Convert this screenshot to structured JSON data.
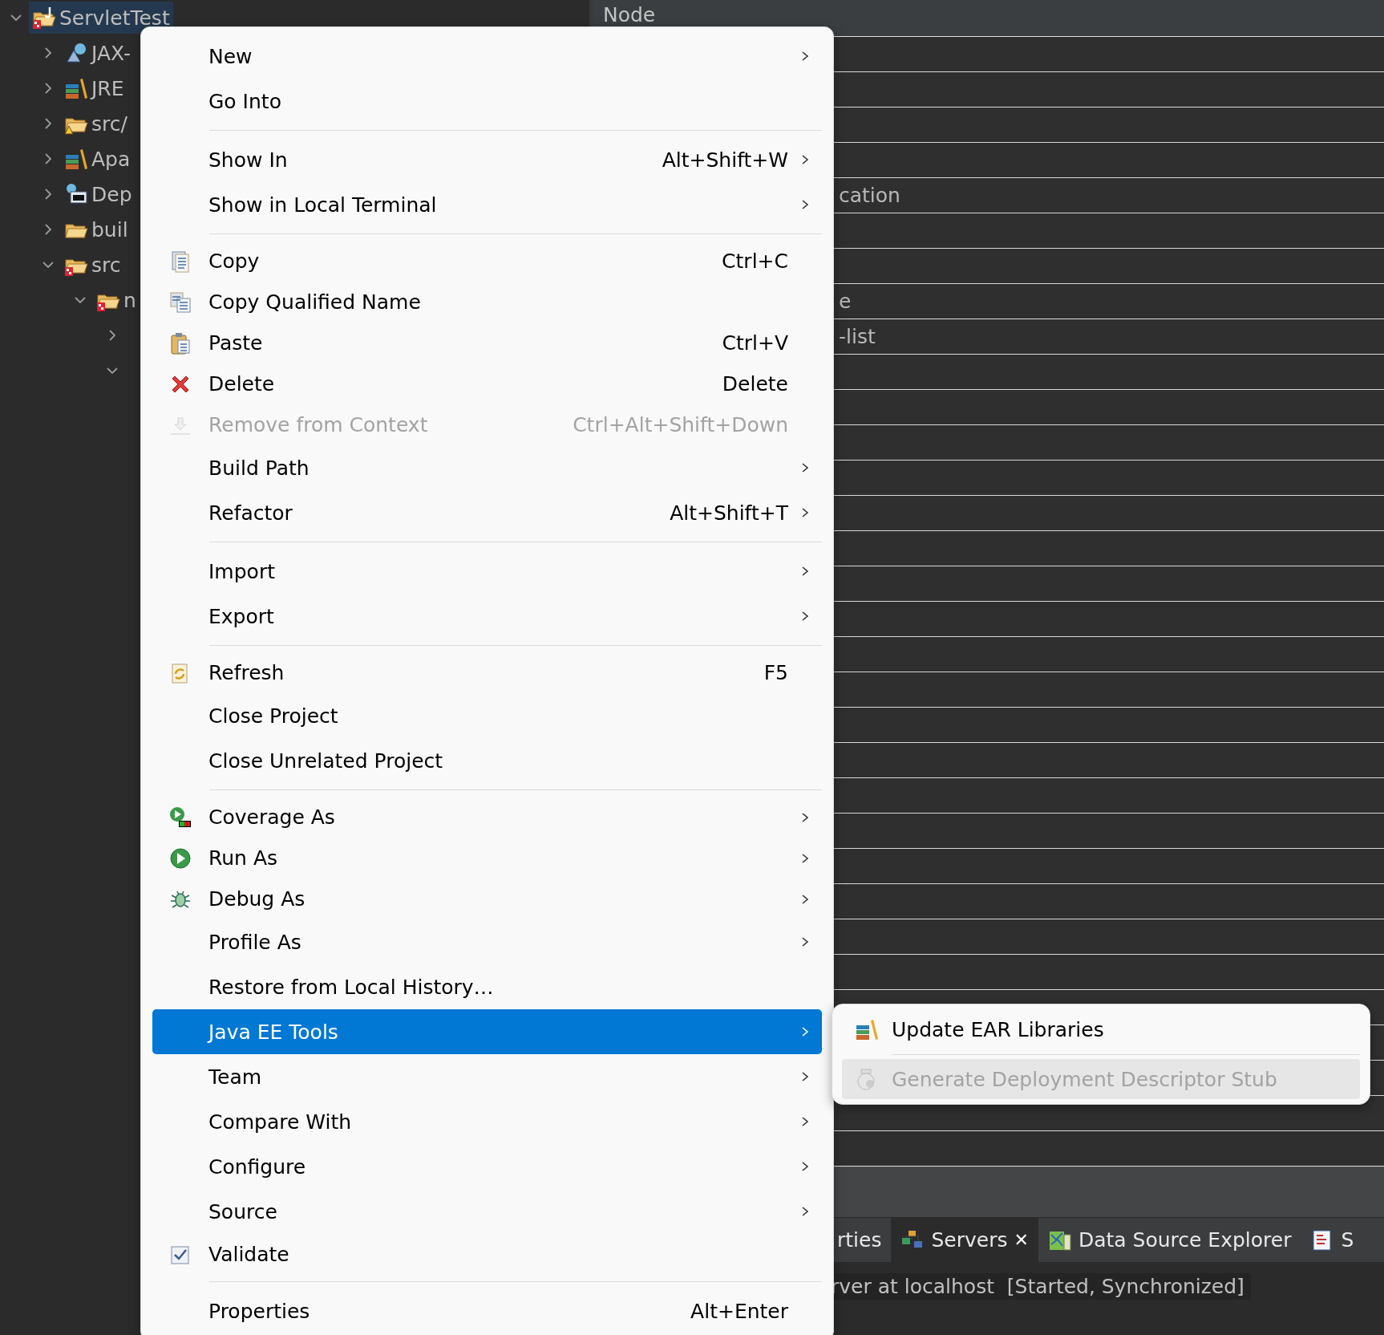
{
  "project_tree": {
    "items": [
      {
        "label": "ServletTest",
        "expanded": true,
        "selected": true,
        "children": [
          {
            "label": "JAX-",
            "expanded": false,
            "selected": false
          },
          {
            "label": "JRE",
            "expanded": false,
            "selected": false
          },
          {
            "label": "src/",
            "expanded": false,
            "selected": false
          },
          {
            "label": "Apa",
            "expanded": false,
            "selected": false
          },
          {
            "label": "Dep",
            "expanded": false,
            "selected": false
          },
          {
            "label": "buil",
            "expanded": false,
            "selected": false
          },
          {
            "label": "src",
            "expanded": true,
            "selected": false,
            "children": [
              {
                "label": "n",
                "expanded": true,
                "selected": false,
                "children": [
                  {
                    "expanded": false
                  },
                  {
                    "expanded": true
                  }
                ]
              }
            ]
          }
        ]
      }
    ]
  },
  "outline": {
    "header": "Node",
    "rows": [
      {
        "kind": "blank"
      },
      {
        "kind": "blank"
      },
      {
        "kind": "blank"
      },
      {
        "kind": "blank"
      },
      {
        "kind": "text",
        "text": "cation"
      },
      {
        "kind": "blank"
      },
      {
        "kind": "blank"
      },
      {
        "kind": "text",
        "text": "e"
      },
      {
        "kind": "text",
        "text": "-list"
      },
      {
        "kind": "blank"
      },
      {
        "kind": "blank"
      },
      {
        "kind": "blank"
      },
      {
        "kind": "blank"
      },
      {
        "kind": "blank"
      },
      {
        "kind": "blank"
      },
      {
        "kind": "blank"
      },
      {
        "kind": "blank"
      },
      {
        "kind": "blank"
      },
      {
        "kind": "blank"
      },
      {
        "kind": "blank"
      },
      {
        "kind": "blank"
      },
      {
        "kind": "blank"
      },
      {
        "kind": "blank"
      },
      {
        "kind": "blank"
      },
      {
        "kind": "blank"
      },
      {
        "kind": "blank"
      },
      {
        "kind": "blank"
      },
      {
        "kind": "blank"
      },
      {
        "kind": "blank"
      },
      {
        "kind": "blank"
      },
      {
        "kind": "blank"
      },
      {
        "kind": "blank"
      }
    ]
  },
  "bottom_panel": {
    "tabs": [
      {
        "label": "rties",
        "selected": false,
        "closable": false
      },
      {
        "label": "Servers",
        "selected": true,
        "closable": true,
        "close_label": "✕"
      },
      {
        "label": "Data Source Explorer",
        "selected": false,
        "closable": false
      },
      {
        "label": "S",
        "selected": false,
        "closable": false
      }
    ],
    "server_line": "rver at localhost  [Started, Synchronized]"
  },
  "context_menu": {
    "items": [
      {
        "kind": "item",
        "label": "New",
        "has_submenu": true,
        "disabled": false,
        "selected": false
      },
      {
        "kind": "item",
        "label": "Go Into",
        "has_submenu": false,
        "disabled": false,
        "selected": false
      },
      {
        "kind": "separator"
      },
      {
        "kind": "item",
        "label": "Show In",
        "shortcut": "Alt+Shift+W",
        "has_submenu": true,
        "disabled": false,
        "selected": false
      },
      {
        "kind": "item",
        "label": "Show in Local Terminal",
        "has_submenu": true,
        "disabled": false,
        "selected": false
      },
      {
        "kind": "separator"
      },
      {
        "kind": "item",
        "label": "Copy",
        "shortcut": "Ctrl+C",
        "has_submenu": false,
        "disabled": false,
        "selected": false
      },
      {
        "kind": "item",
        "label": "Copy Qualified Name",
        "has_submenu": false,
        "disabled": false,
        "selected": false
      },
      {
        "kind": "item",
        "label": "Paste",
        "shortcut": "Ctrl+V",
        "has_submenu": false,
        "disabled": false,
        "selected": false
      },
      {
        "kind": "item",
        "label": "Delete",
        "shortcut": "Delete",
        "has_submenu": false,
        "disabled": false,
        "selected": false
      },
      {
        "kind": "item",
        "label": "Remove from Context",
        "shortcut": "Ctrl+Alt+Shift+Down",
        "has_submenu": false,
        "disabled": true,
        "selected": false
      },
      {
        "kind": "item",
        "label": "Build Path",
        "has_submenu": true,
        "disabled": false,
        "selected": false
      },
      {
        "kind": "item",
        "label": "Refactor",
        "shortcut": "Alt+Shift+T",
        "has_submenu": true,
        "disabled": false,
        "selected": false
      },
      {
        "kind": "separator"
      },
      {
        "kind": "item",
        "label": "Import",
        "has_submenu": true,
        "disabled": false,
        "selected": false
      },
      {
        "kind": "item",
        "label": "Export",
        "has_submenu": true,
        "disabled": false,
        "selected": false
      },
      {
        "kind": "separator"
      },
      {
        "kind": "item",
        "label": "Refresh",
        "shortcut": "F5",
        "has_submenu": false,
        "disabled": false,
        "selected": false
      },
      {
        "kind": "item",
        "label": "Close Project",
        "has_submenu": false,
        "disabled": false,
        "selected": false
      },
      {
        "kind": "item",
        "label": "Close Unrelated Project",
        "has_submenu": false,
        "disabled": false,
        "selected": false
      },
      {
        "kind": "separator"
      },
      {
        "kind": "item",
        "label": "Coverage As",
        "has_submenu": true,
        "disabled": false,
        "selected": false
      },
      {
        "kind": "item",
        "label": "Run As",
        "has_submenu": true,
        "disabled": false,
        "selected": false
      },
      {
        "kind": "item",
        "label": "Debug As",
        "has_submenu": true,
        "disabled": false,
        "selected": false
      },
      {
        "kind": "item",
        "label": "Profile As",
        "has_submenu": true,
        "disabled": false,
        "selected": false
      },
      {
        "kind": "item",
        "label": "Restore from Local History…",
        "has_submenu": false,
        "disabled": false,
        "selected": false
      },
      {
        "kind": "item",
        "label": "Java EE Tools",
        "has_submenu": true,
        "disabled": false,
        "selected": true,
        "submenu": {
          "items": [
            {
              "kind": "item",
              "label": "Update EAR Libraries",
              "disabled": false,
              "hovered": false
            },
            {
              "kind": "separator"
            },
            {
              "kind": "item",
              "label": "Generate Deployment Descriptor Stub",
              "disabled": true,
              "hovered": true
            }
          ]
        }
      },
      {
        "kind": "item",
        "label": "Team",
        "has_submenu": true,
        "disabled": false,
        "selected": false
      },
      {
        "kind": "item",
        "label": "Compare With",
        "has_submenu": true,
        "disabled": false,
        "selected": false
      },
      {
        "kind": "item",
        "label": "Configure",
        "has_submenu": true,
        "disabled": false,
        "selected": false
      },
      {
        "kind": "item",
        "label": "Source",
        "has_submenu": true,
        "disabled": false,
        "selected": false
      },
      {
        "kind": "item",
        "label": "Validate",
        "has_submenu": false,
        "disabled": false,
        "selected": false
      },
      {
        "kind": "separator"
      },
      {
        "kind": "item",
        "label": "Properties",
        "shortcut": "Alt+Enter",
        "has_submenu": false,
        "disabled": false,
        "selected": false
      }
    ]
  }
}
